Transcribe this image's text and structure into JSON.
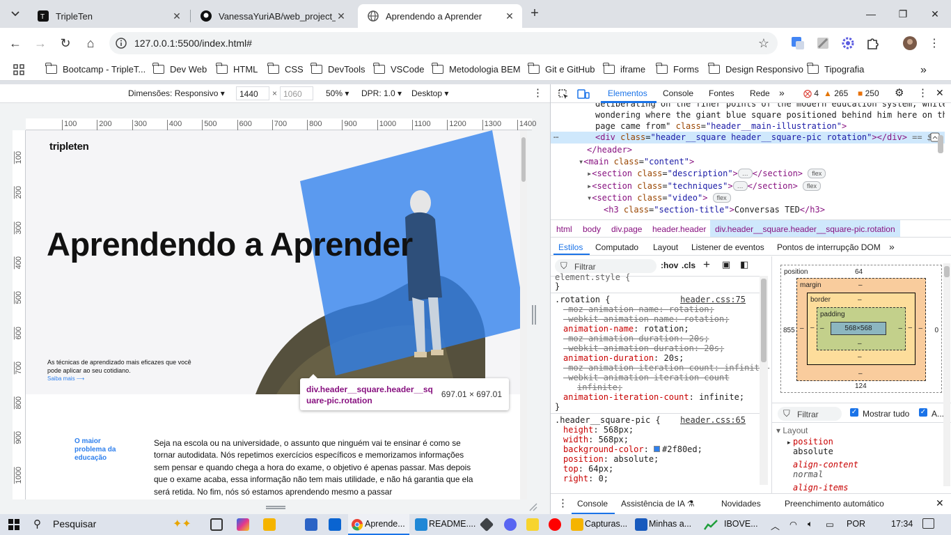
{
  "browser": {
    "tabs": [
      {
        "title": "TripleTen",
        "active": false
      },
      {
        "title": "VanessaYuriAB/web_project_co",
        "active": false
      },
      {
        "title": "Aprendendo a Aprender",
        "active": true
      }
    ],
    "url": "127.0.0.1:5500/index.html#",
    "bookmarks": [
      "Bootcamp - TripleT...",
      "Dev Web",
      "HTML",
      "CSS",
      "DevTools",
      "VSCode",
      "Metodologia BEM",
      "Git e GitHub",
      "iframe",
      "Forms",
      "Design Responsivo",
      "Tipografia"
    ]
  },
  "device_toolbar": {
    "dimensions_label": "Dimensões: Responsivo",
    "width": "1440",
    "height": "1060",
    "zoom": "50%",
    "dpr": "DPR: 1.0",
    "mode": "Desktop"
  },
  "ruler": {
    "top_ticks": [
      "100",
      "200",
      "300",
      "400",
      "500",
      "600",
      "700",
      "800",
      "900",
      "1000",
      "1100",
      "1200",
      "1300",
      "1400"
    ],
    "left_ticks": [
      "100",
      "200",
      "300",
      "400",
      "500",
      "600",
      "700",
      "800",
      "900",
      "1000"
    ]
  },
  "page": {
    "logo": "tripleten",
    "title": "Aprendendo a Aprender",
    "subtitle": "As técnicas de aprendizado mais eficazes que você pode aplicar ao seu cotidiano.",
    "link": "Saiba mais ⟶",
    "section_title": "O maior problema da educação",
    "paragraph": "Seja na escola ou na universidade, o assunto que ninguém vai te ensinar é como se tornar autodidata. Nós repetimos exercícios específicos e memorizamos informações sem pensar e quando chega a hora do exame, o objetivo é apenas passar. Mas depois que o exame acaba, essa informação não tem mais utilidade, e não há garantia que ela será retida. No fim, nós só estamos aprendendo mesmo a passar",
    "accent": "#2f80ed"
  },
  "tooltip": {
    "selector": "div.header__square.header__square-pic.rotation",
    "size": "697.01 × 697.01"
  },
  "devtools": {
    "tabs": [
      "Elementos",
      "Console",
      "Fontes",
      "Rede"
    ],
    "errors": "4",
    "warnings": "265",
    "issues": "250",
    "elements": {
      "line1": "deliberating on the finer points of the modern education system, while also",
      "line2": "wondering where the giant blue square positioned behind him here on the web",
      "line3a": "page came from\" ",
      "line3_attr": "class",
      "line3_val": "\"header__main-illustration\"",
      "sel_tag_open": "<div ",
      "sel_attr": "class",
      "sel_val": "\"header__square header__square-pic rotation\"",
      "sel_tag_close": "></div>",
      "sel_eq": " == $0",
      "header_close": "</header>",
      "main_open": "<main ",
      "main_attr": "class",
      "main_val": "\"content\"",
      "sec1_val": "\"description\"",
      "sec2_val": "\"techniques\"",
      "sec3_val": "\"video\"",
      "section_tag": "<section ",
      "section_close": "</section>",
      "h3_open": "<h3 ",
      "h3_val": "\"section-title\"",
      "h3_text": "Conversas TED",
      "h3_close": "</h3>",
      "flex": "flex",
      "ellipsis": "…"
    },
    "breadcrumbs": [
      "html",
      "body",
      "div.page",
      "header.header",
      "div.header__square.header__square-pic.rotation"
    ],
    "subtabs": [
      "Estilos",
      "Computado",
      "Layout",
      "Listener de eventos",
      "Pontos de interrupção DOM"
    ],
    "filter_placeholder": "Filtrar",
    "hov": ":hov",
    "cls": ".cls",
    "styles": {
      "element_style": "element.style {",
      "close": "}",
      "rule1_selector": ".rotation {",
      "rule1_source": "header.css:75",
      "rule1_props": [
        {
          "name": "-moz-animation-name",
          "value": "rotation;",
          "struck": true
        },
        {
          "name": "-webkit-animation-name",
          "value": "rotation;",
          "struck": true
        },
        {
          "name": "animation-name",
          "value": "rotation;",
          "struck": false
        },
        {
          "name": "-moz-animation-duration",
          "value": "20s;",
          "struck": true
        },
        {
          "name": "-webkit-animation-duration",
          "value": "20s;",
          "struck": true
        },
        {
          "name": "animation-duration",
          "value": "20s;",
          "struck": false
        },
        {
          "name": "-moz-animation-iteration-count",
          "value": "infinite;",
          "struck": true
        },
        {
          "name": "-webkit-animation-iteration-count",
          "value": "",
          "struck": true
        },
        {
          "name": "",
          "value": "infinite;",
          "struck": true
        },
        {
          "name": "animation-iteration-count",
          "value": "infinite;",
          "struck": false
        }
      ],
      "rule2_selector": ".header__square-pic {",
      "rule2_source": "header.css:65",
      "rule2_props": [
        {
          "name": "height",
          "value": "568px;"
        },
        {
          "name": "width",
          "value": "568px;"
        },
        {
          "name": "background-color",
          "value": "#2f80ed;"
        },
        {
          "name": "position",
          "value": "absolute;"
        },
        {
          "name": "top",
          "value": "64px;"
        },
        {
          "name": "right",
          "value": "0;"
        }
      ]
    },
    "boxmodel": {
      "position_label": "position",
      "position_top": "64",
      "position_left": "855",
      "position_right": "0",
      "position_bottom": "124",
      "margin_label": "margin",
      "border_label": "border",
      "padding_label": "padding",
      "dash": "–",
      "content": "568×568"
    },
    "computed": {
      "filter": "Filtrar",
      "show_all": "Mostrar tudo",
      "a_label": "A...",
      "layout_label": "Layout",
      "props": [
        {
          "name": "position",
          "value": "absolute"
        },
        {
          "name": "align-content",
          "value": "normal"
        },
        {
          "name": "align-items",
          "value": ""
        }
      ]
    },
    "drawer_tabs": [
      "Console",
      "Assistência de IA",
      "Novidades",
      "Preenchimento automático"
    ]
  },
  "taskbar": {
    "search": "Pesquisar",
    "apps": [
      "Aprende...",
      "README....",
      "Capturas...",
      "Minhas a...",
      "IBOVE..."
    ],
    "lang": "POR",
    "time": "17:34"
  }
}
